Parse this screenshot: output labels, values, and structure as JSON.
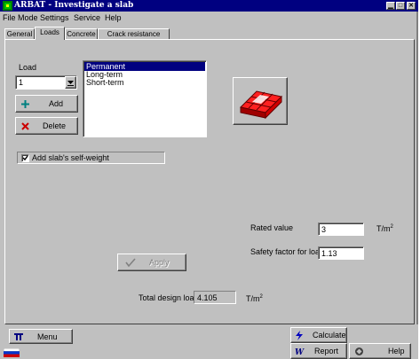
{
  "window": {
    "title": "ARBAT - Investigate a slab",
    "controls": [
      "minimize-icon",
      "maximize-icon",
      "close-icon"
    ],
    "control_glyphs": [
      "▁",
      "□",
      "✕"
    ]
  },
  "menu": [
    "File",
    "Mode",
    "Settings",
    "Service",
    "Help"
  ],
  "tabs": [
    {
      "label": "General",
      "active": false
    },
    {
      "label": "Loads",
      "active": true
    },
    {
      "label": "Concrete",
      "active": false
    },
    {
      "label": "Crack resistance",
      "active": false
    }
  ],
  "load": {
    "label": "Load",
    "selected": "1",
    "add_label": "Add",
    "delete_label": "Delete",
    "types": [
      "Permanent",
      "Long-term",
      "Short-term"
    ],
    "selected_type": "Permanent"
  },
  "selfweight": {
    "label": "Add slab's self-weight",
    "checked": true
  },
  "rated_value": {
    "label": "Rated value",
    "value": "3",
    "unit": "T/m",
    "unit_sup": "2"
  },
  "safety_factor": {
    "label": "Safety factor for load",
    "value": "1.13"
  },
  "apply_label": "Apply",
  "total": {
    "label": "Total design load",
    "value": "4.105",
    "unit": "T/m",
    "unit_sup": "2"
  },
  "bottom": {
    "menu_label": "Menu",
    "calculate_label": "Calculate",
    "report_label": "Report",
    "help_label": "Help"
  },
  "colors": {
    "titlebar": "#000080",
    "selection": "#000080",
    "slab": "#cc0000"
  }
}
